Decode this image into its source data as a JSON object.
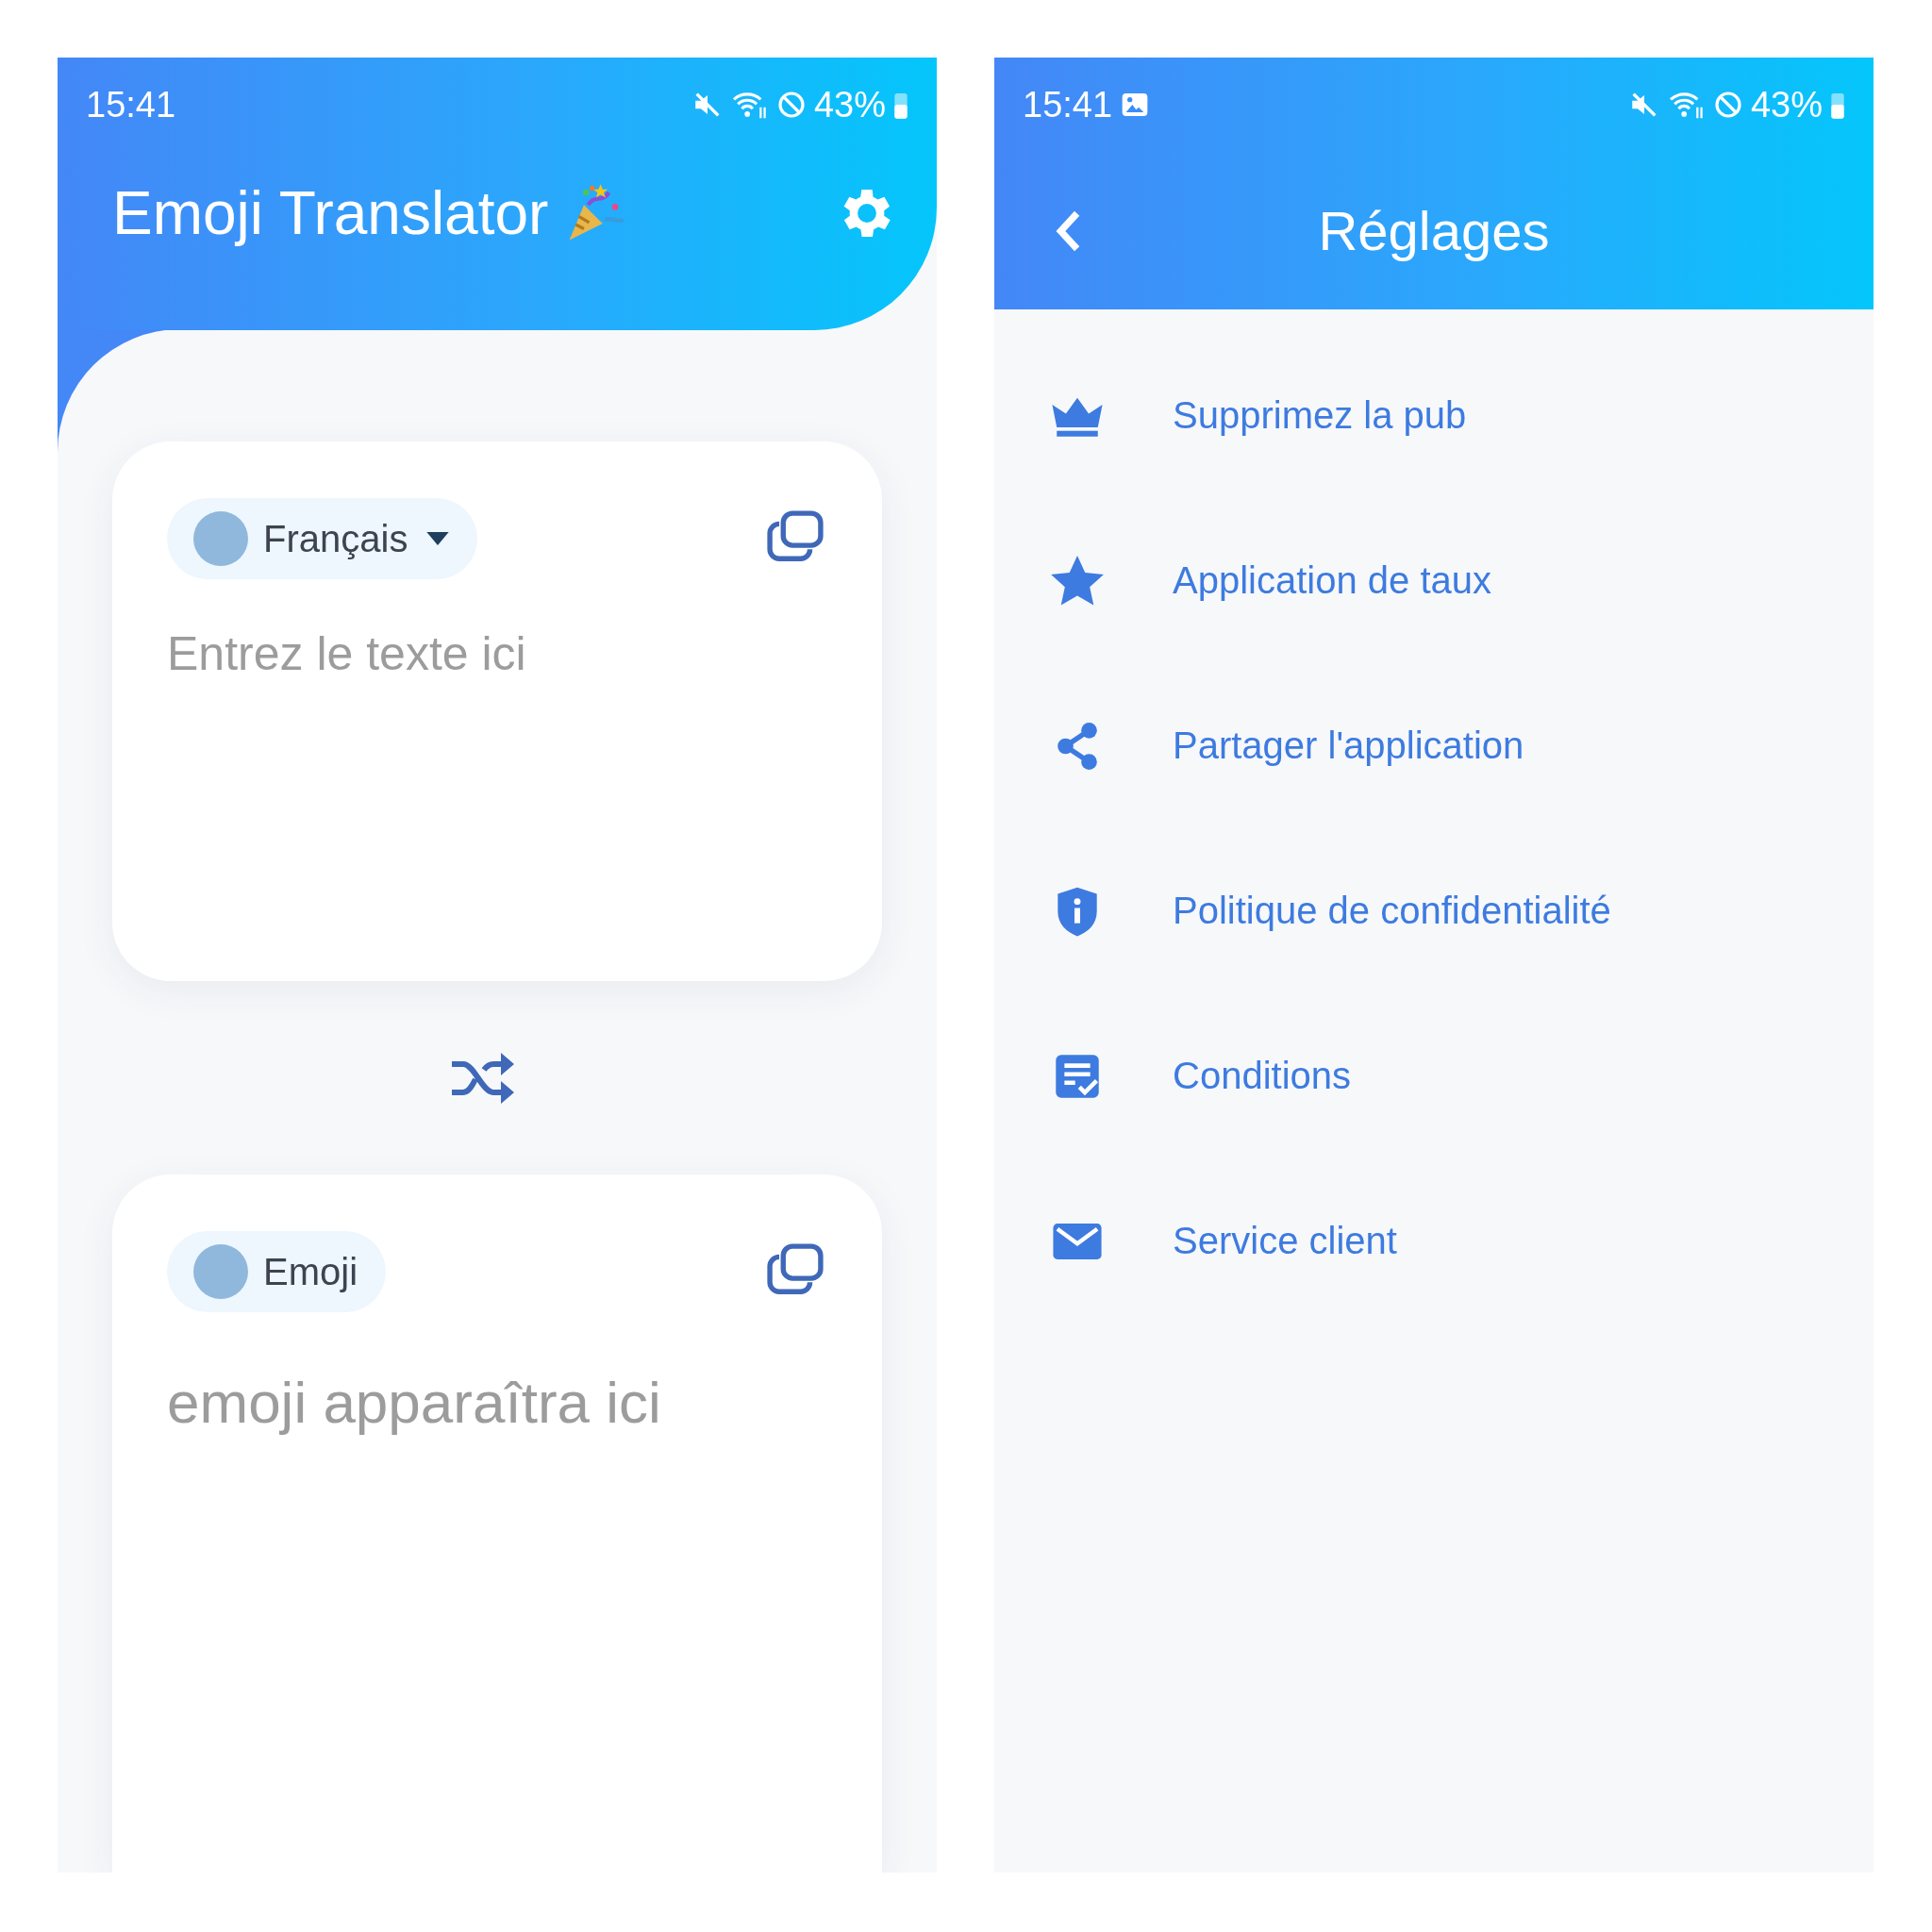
{
  "translator_screen": {
    "status_bar": {
      "time": "15:41",
      "battery": "43%",
      "image_notification": false
    },
    "title": "Emoji Translator",
    "source_card": {
      "language": "Français",
      "dropdown": true,
      "placeholder": "Entrez le texte ici"
    },
    "target_card": {
      "language": "Emoji",
      "dropdown": false,
      "placeholder": "emoji apparaîtra ici"
    }
  },
  "settings_screen": {
    "status_bar": {
      "time": "15:41",
      "battery": "43%",
      "image_notification": true
    },
    "title": "Réglages",
    "items": [
      {
        "kind": "crown",
        "label": "Supprimez la pub"
      },
      {
        "kind": "star",
        "label": "Application de taux"
      },
      {
        "kind": "share",
        "label": "Partager l'application"
      },
      {
        "kind": "shield",
        "label": "Politique de confidentialité"
      },
      {
        "kind": "document",
        "label": "Conditions"
      },
      {
        "kind": "mail",
        "label": "Service client"
      }
    ]
  }
}
